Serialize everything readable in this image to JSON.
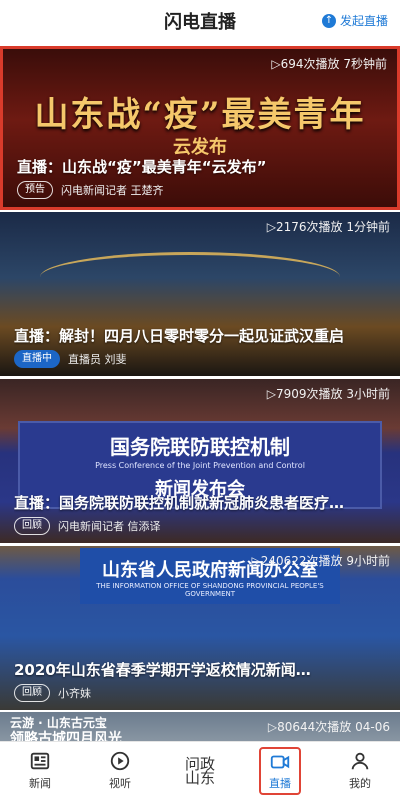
{
  "header": {
    "title": "闪电直播",
    "start_label": "发起直播"
  },
  "cards": [
    {
      "meta": "▷694次播放 7秒钟前",
      "big_title": "山东战“疫”最美青年",
      "sub_title": "云发布",
      "caption": "直播：山东战“疫”最美青年“云发布”",
      "badge": "预告",
      "author": "闪电新闻记者 王楚齐"
    },
    {
      "meta": "▷2176次播放 1分钟前",
      "caption": "直播：解封！四月八日零时零分一起见证武汉重启",
      "badge": "直播中",
      "author": "直播员 刘斐"
    },
    {
      "meta": "▷7909次播放 3小时前",
      "board_title": "国务院联防联控机制",
      "board_en": "Press Conference of the Joint Prevention and Control",
      "board_sub": "新闻发布会",
      "caption": "直播：国务院联防联控机制就新冠肺炎患者医疗…",
      "badge": "回顾",
      "author": "闪电新闻记者 信添译"
    },
    {
      "meta": "▷240622次播放 9小时前",
      "board_title": "山东省人民政府新闻办公室",
      "board_en": "THE INFORMATION OFFICE OF SHANDONG PROVINCIAL PEOPLE'S GOVERNMENT",
      "caption": "2020年山东省春季学期开学返校情况新闻…",
      "badge": "回顾",
      "author": "小齐妹"
    },
    {
      "meta": "▷80644次播放 04-06",
      "line1": "云游 · 山东古元宝",
      "line2": "领略古城四月风光"
    }
  ],
  "tabs": [
    {
      "label": "新闻",
      "icon": "news-icon"
    },
    {
      "label": "视听",
      "icon": "play-icon"
    },
    {
      "label": "问政山东",
      "logo_line1": "问政",
      "logo_line2": "山东",
      "icon": "wenzheng-logo"
    },
    {
      "label": "直播",
      "icon": "live-camera-icon",
      "active": true
    },
    {
      "label": "我的",
      "icon": "person-icon"
    }
  ],
  "colors": {
    "accent": "#1f7ad6",
    "highlight_border": "#d93b2b"
  }
}
